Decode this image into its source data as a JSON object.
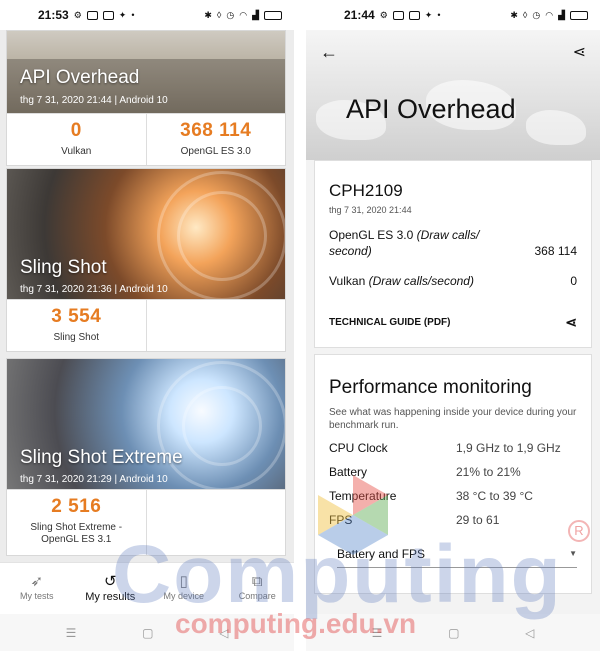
{
  "left_phone": {
    "status_bar": {
      "time": "21:53"
    },
    "cards": [
      {
        "title": "API Overhead",
        "subtitle": "thg 7 31, 2020 21:44 | Android 10",
        "scores": [
          {
            "value": "0",
            "label": "Vulkan"
          },
          {
            "value": "368 114",
            "label": "OpenGL ES 3.0"
          }
        ]
      },
      {
        "title": "Sling Shot",
        "subtitle": "thg 7 31, 2020 21:36 | Android 10",
        "scores": [
          {
            "value": "3 554",
            "label": "Sling Shot"
          }
        ]
      },
      {
        "title": "Sling Shot Extreme",
        "subtitle": "thg 7 31, 2020 21:29 | Android 10",
        "scores": [
          {
            "value": "2 516",
            "label": "Sling Shot Extreme - OpenGL ES 3.1"
          }
        ]
      }
    ],
    "bottom_nav": [
      {
        "label": "My tests",
        "icon": "runner-icon",
        "active": false
      },
      {
        "label": "My results",
        "icon": "history-icon",
        "active": true
      },
      {
        "label": "My device",
        "icon": "device-icon",
        "active": false
      },
      {
        "label": "Compare",
        "icon": "compare-icon",
        "active": false
      }
    ]
  },
  "right_phone": {
    "status_bar": {
      "time": "21:44"
    },
    "header_title": "API Overhead",
    "result_card": {
      "device": "CPH2109",
      "date": "thg 7 31, 2020 21:44",
      "rows": [
        {
          "name": "OpenGL ES 3.0",
          "unit": "(Draw calls/ second)",
          "value": "368 114"
        },
        {
          "name": "Vulkan",
          "unit": "(Draw calls/second)",
          "value": "0"
        }
      ],
      "technical_guide": "TECHNICAL GUIDE (PDF)"
    },
    "performance": {
      "title": "Performance monitoring",
      "description": "See what was happening inside your device during your benchmark run.",
      "rows": [
        {
          "key": "CPU Clock",
          "value": "1,9 GHz to 1,9 GHz"
        },
        {
          "key": "Battery",
          "value": "21% to 21%"
        },
        {
          "key": "Temperature",
          "value": "38 °C to 39 °C"
        },
        {
          "key": "FPS",
          "value": "29 to 61"
        }
      ],
      "dropdown": "Battery and FPS"
    }
  },
  "watermark": {
    "main": "Computing",
    "domain": "computing.edu.vn",
    "mark": "R"
  },
  "colors": {
    "score": "#e67c22"
  }
}
